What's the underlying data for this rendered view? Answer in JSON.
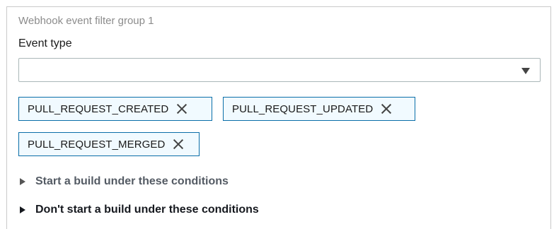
{
  "group": {
    "title": "Webhook event filter group 1"
  },
  "event_type": {
    "label": "Event type",
    "selected_value": "",
    "icons": {
      "dropdown": "caret-down-icon"
    },
    "tokens": [
      {
        "label": "PULL_REQUEST_CREATED",
        "remove_icon": "close-icon"
      },
      {
        "label": "PULL_REQUEST_UPDATED",
        "remove_icon": "close-icon"
      },
      {
        "label": "PULL_REQUEST_MERGED",
        "remove_icon": "close-icon"
      }
    ]
  },
  "conditions": {
    "start_label": "Start a build under these conditions",
    "dont_start_label": "Don't start a build under these conditions",
    "icons": {
      "expand": "caret-right-icon"
    }
  },
  "colors": {
    "token_border": "#0a6ea8",
    "token_background": "#f1faff",
    "muted_text": "#8c8c8c",
    "secondary_text": "#545b64"
  }
}
